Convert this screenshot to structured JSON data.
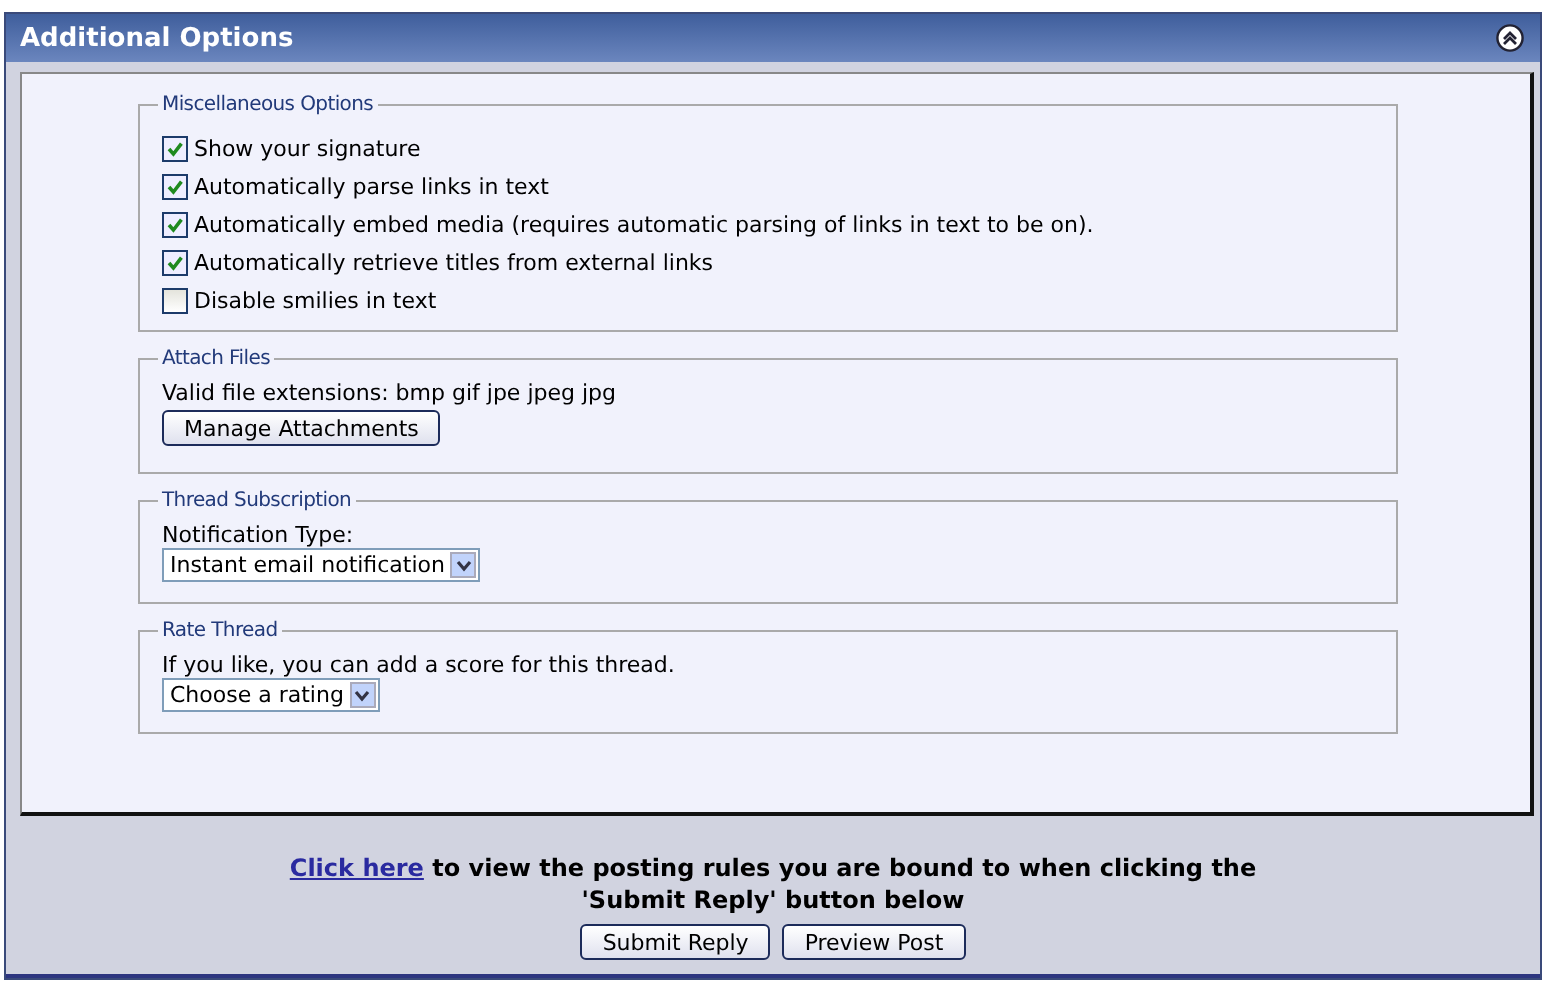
{
  "panel": {
    "title": "Additional Options"
  },
  "misc_options": {
    "legend": "Miscellaneous Options",
    "options": [
      {
        "label": "Show your signature",
        "checked": true
      },
      {
        "label": "Automatically parse links in text",
        "checked": true
      },
      {
        "label": "Automatically embed media (requires automatic parsing of links in text to be on).",
        "checked": true
      },
      {
        "label": "Automatically retrieve titles from external links",
        "checked": true
      },
      {
        "label": "Disable smilies in text",
        "checked": false
      }
    ]
  },
  "attach_files": {
    "legend": "Attach Files",
    "text": "Valid file extensions: bmp gif jpe jpeg jpg",
    "button": "Manage Attachments"
  },
  "thread_subscription": {
    "legend": "Thread Subscription",
    "label": "Notification Type:",
    "value": "Instant email notification"
  },
  "rate_thread": {
    "legend": "Rate Thread",
    "text": "If you like, you can add a score for this thread.",
    "value": "Choose a rating"
  },
  "footer": {
    "link": "Click here",
    "note": "to view the posting rules you are bound to when clicking the 'Submit Reply' button below",
    "buttons": [
      "Submit Reply",
      "Preview Post"
    ]
  }
}
